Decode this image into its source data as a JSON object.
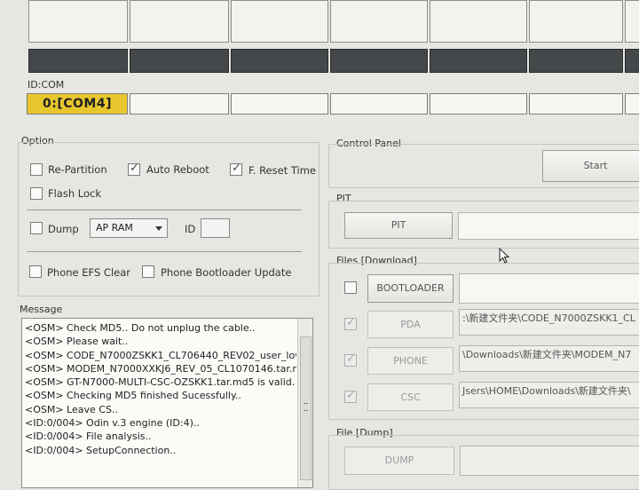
{
  "idcom": {
    "label": "ID:COM",
    "ports": [
      "0:[COM4]",
      "",
      "",
      "",
      "",
      "",
      ""
    ]
  },
  "option": {
    "title": "Option",
    "re_partition": {
      "label": "Re-Partition",
      "checked": false
    },
    "auto_reboot": {
      "label": "Auto Reboot",
      "checked": true
    },
    "f_reset_time": {
      "label": "F. Reset Time",
      "checked": true
    },
    "flash_lock": {
      "label": "Flash Lock",
      "checked": false
    },
    "dump": {
      "label": "Dump",
      "checked": false
    },
    "dump_target": "AP RAM",
    "id_label": "ID",
    "phone_efs_clear": {
      "label": "Phone EFS Clear",
      "checked": false
    },
    "phone_bootloader_update": {
      "label": "Phone Bootloader Update",
      "checked": false
    }
  },
  "message": {
    "title": "Message",
    "lines": [
      "<OSM> Check MD5.. Do not unplug the cable..",
      "<OSM> Please wait..",
      "<OSM> CODE_N7000ZSKK1_CL706440_REV02_user_lov",
      "<OSM> MODEM_N7000XXKJ6_REV_05_CL1070146.tar.r",
      "<OSM> GT-N7000-MULTI-CSC-OZSKK1.tar.md5 is valid.",
      "<OSM> Checking MD5 finished Sucessfully..",
      "<OSM> Leave CS..",
      "<ID:0/004> Odin v.3 engine (ID:4)..",
      "<ID:0/004> File analysis..",
      "<ID:0/004> SetupConnection.."
    ]
  },
  "control_panel": {
    "title": "Control Panel",
    "start_label": "Start"
  },
  "pit": {
    "title": "PIT",
    "button_label": "PIT",
    "path": ""
  },
  "files_download": {
    "title": "Files [Download]",
    "bootloader": {
      "label": "BOOTLOADER",
      "checked": false,
      "path": ""
    },
    "pda": {
      "label": "PDA",
      "checked": true,
      "path": ":\\新建文件夹\\CODE_N7000ZSKK1_CL"
    },
    "phone": {
      "label": "PHONE",
      "checked": true,
      "path": "\\Downloads\\新建文件夹\\MODEM_N7"
    },
    "csc": {
      "label": "CSC",
      "checked": true,
      "path": "Jsers\\HOME\\Downloads\\新建文件夹\\"
    }
  },
  "file_dump": {
    "title": "File [Dump]",
    "button_label": "DUMP",
    "path": ""
  }
}
